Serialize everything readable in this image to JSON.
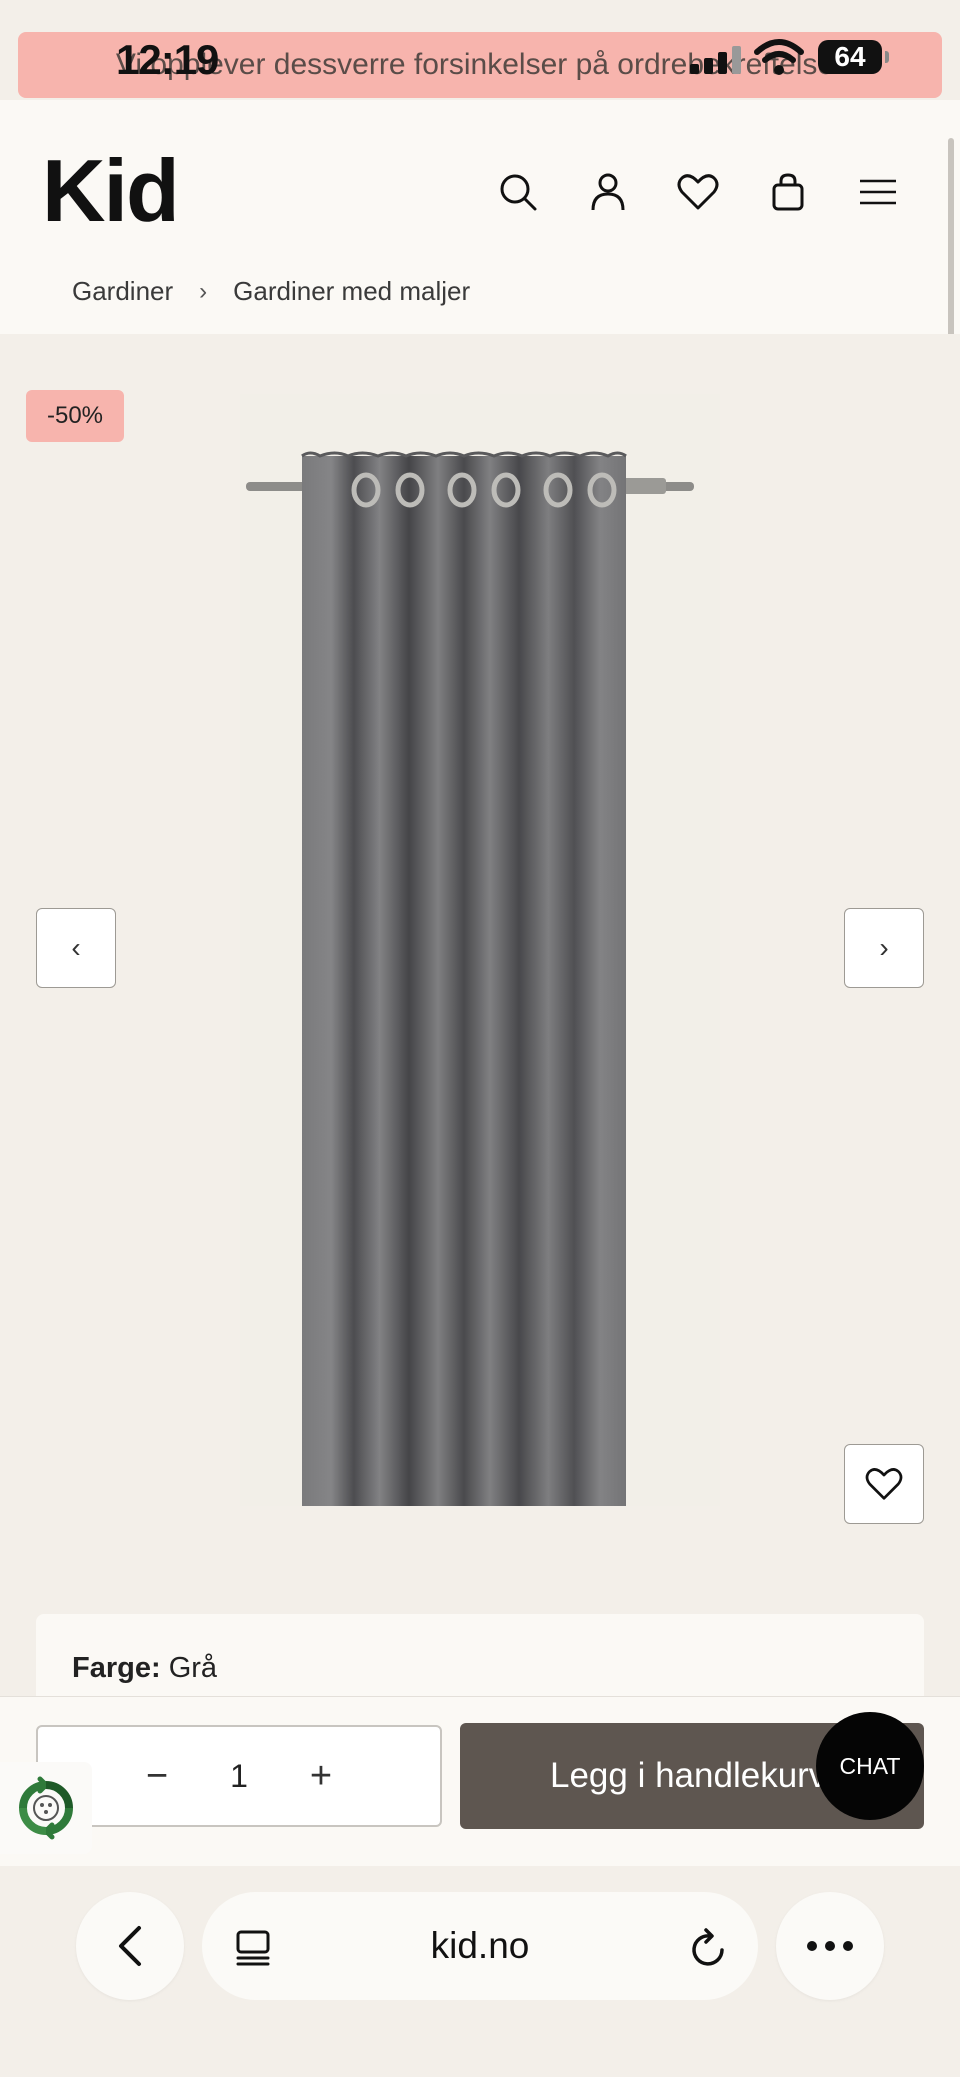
{
  "status_bar": {
    "time": "12:19",
    "battery": "64"
  },
  "banner": {
    "text": "Vi opplever dessverre forsinkelser på ordrebekreftelser"
  },
  "header": {
    "logo": "Kid",
    "icons": [
      "search-icon",
      "user-icon",
      "heart-icon",
      "bag-icon",
      "menu-icon"
    ]
  },
  "breadcrumb": {
    "items": [
      "Gardiner",
      "Gardiner med maljer"
    ],
    "separator": "›"
  },
  "gallery": {
    "discount_badge": "-50%",
    "prev": "‹",
    "next": "›"
  },
  "product": {
    "color_label": "Farge:",
    "color_value": "Grå"
  },
  "buy": {
    "quantity": "1",
    "minus": "−",
    "plus": "+",
    "add_to_cart": "Legg i handlekurv",
    "chat": "CHAT"
  },
  "browser": {
    "url": "kid.no"
  },
  "colors": {
    "banner": "#f7b4ad",
    "add_button": "#5e5650",
    "background": "#f3efe9",
    "header": "#fbf9f5"
  }
}
